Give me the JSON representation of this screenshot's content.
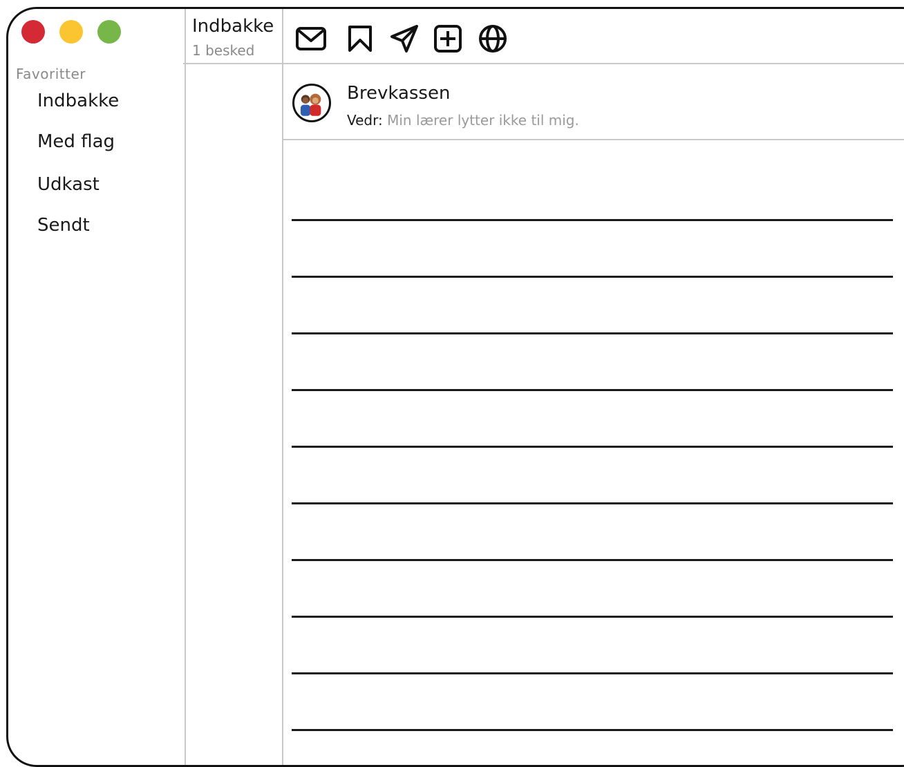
{
  "window": {
    "controls": [
      "close",
      "minimize",
      "maximize"
    ],
    "control_colors": {
      "close": "#d42a35",
      "minimize": "#fbc531",
      "maximize": "#77b74a"
    }
  },
  "sidebar": {
    "section_label": "Favoritter",
    "items": [
      {
        "label": "Indbakke"
      },
      {
        "label": "Med flag"
      },
      {
        "label": "Udkast"
      },
      {
        "label": "Sendt"
      }
    ]
  },
  "folder": {
    "title": "Indbakke",
    "count": "1 besked"
  },
  "toolbar": {
    "icons": [
      "envelope-icon",
      "bookmark-icon",
      "send-icon",
      "add-icon",
      "globe-icon"
    ]
  },
  "message": {
    "sender": "Brevkassen",
    "subject_label": "Vedr:",
    "subject": "Min lærer lytter ikke til mig."
  }
}
